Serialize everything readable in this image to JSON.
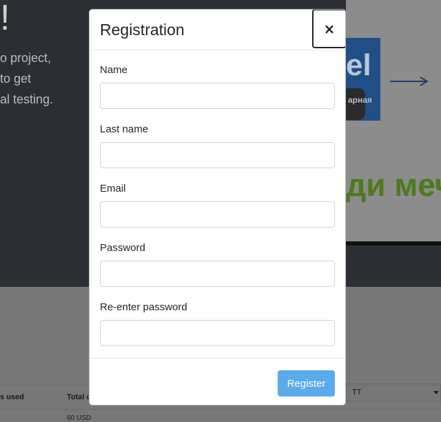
{
  "background": {
    "hero_exclaim": "!",
    "hero_lines": [
      "o project,",
      "to get",
      "al testing."
    ],
    "logo_text": "el",
    "logo_sub": "арная",
    "green_text": "ди меч",
    "table_headers": [
      "s used",
      "Total c"
    ],
    "table_cell": "60 USD",
    "select_value": "TT"
  },
  "modal": {
    "title": "Registration",
    "close_label": "×",
    "fields": [
      {
        "label": "Name",
        "value": "",
        "placeholder": ""
      },
      {
        "label": "Last name",
        "value": "",
        "placeholder": ""
      },
      {
        "label": "Email",
        "value": "",
        "placeholder": ""
      },
      {
        "label": "Password",
        "value": "",
        "placeholder": ""
      },
      {
        "label": "Re-enter password",
        "value": "",
        "placeholder": ""
      }
    ],
    "submit_label": "Register"
  },
  "colors": {
    "primary_button": "#5aabeb",
    "overlay_dark": "#2b2e33",
    "green_text": "#4e7a1e"
  }
}
